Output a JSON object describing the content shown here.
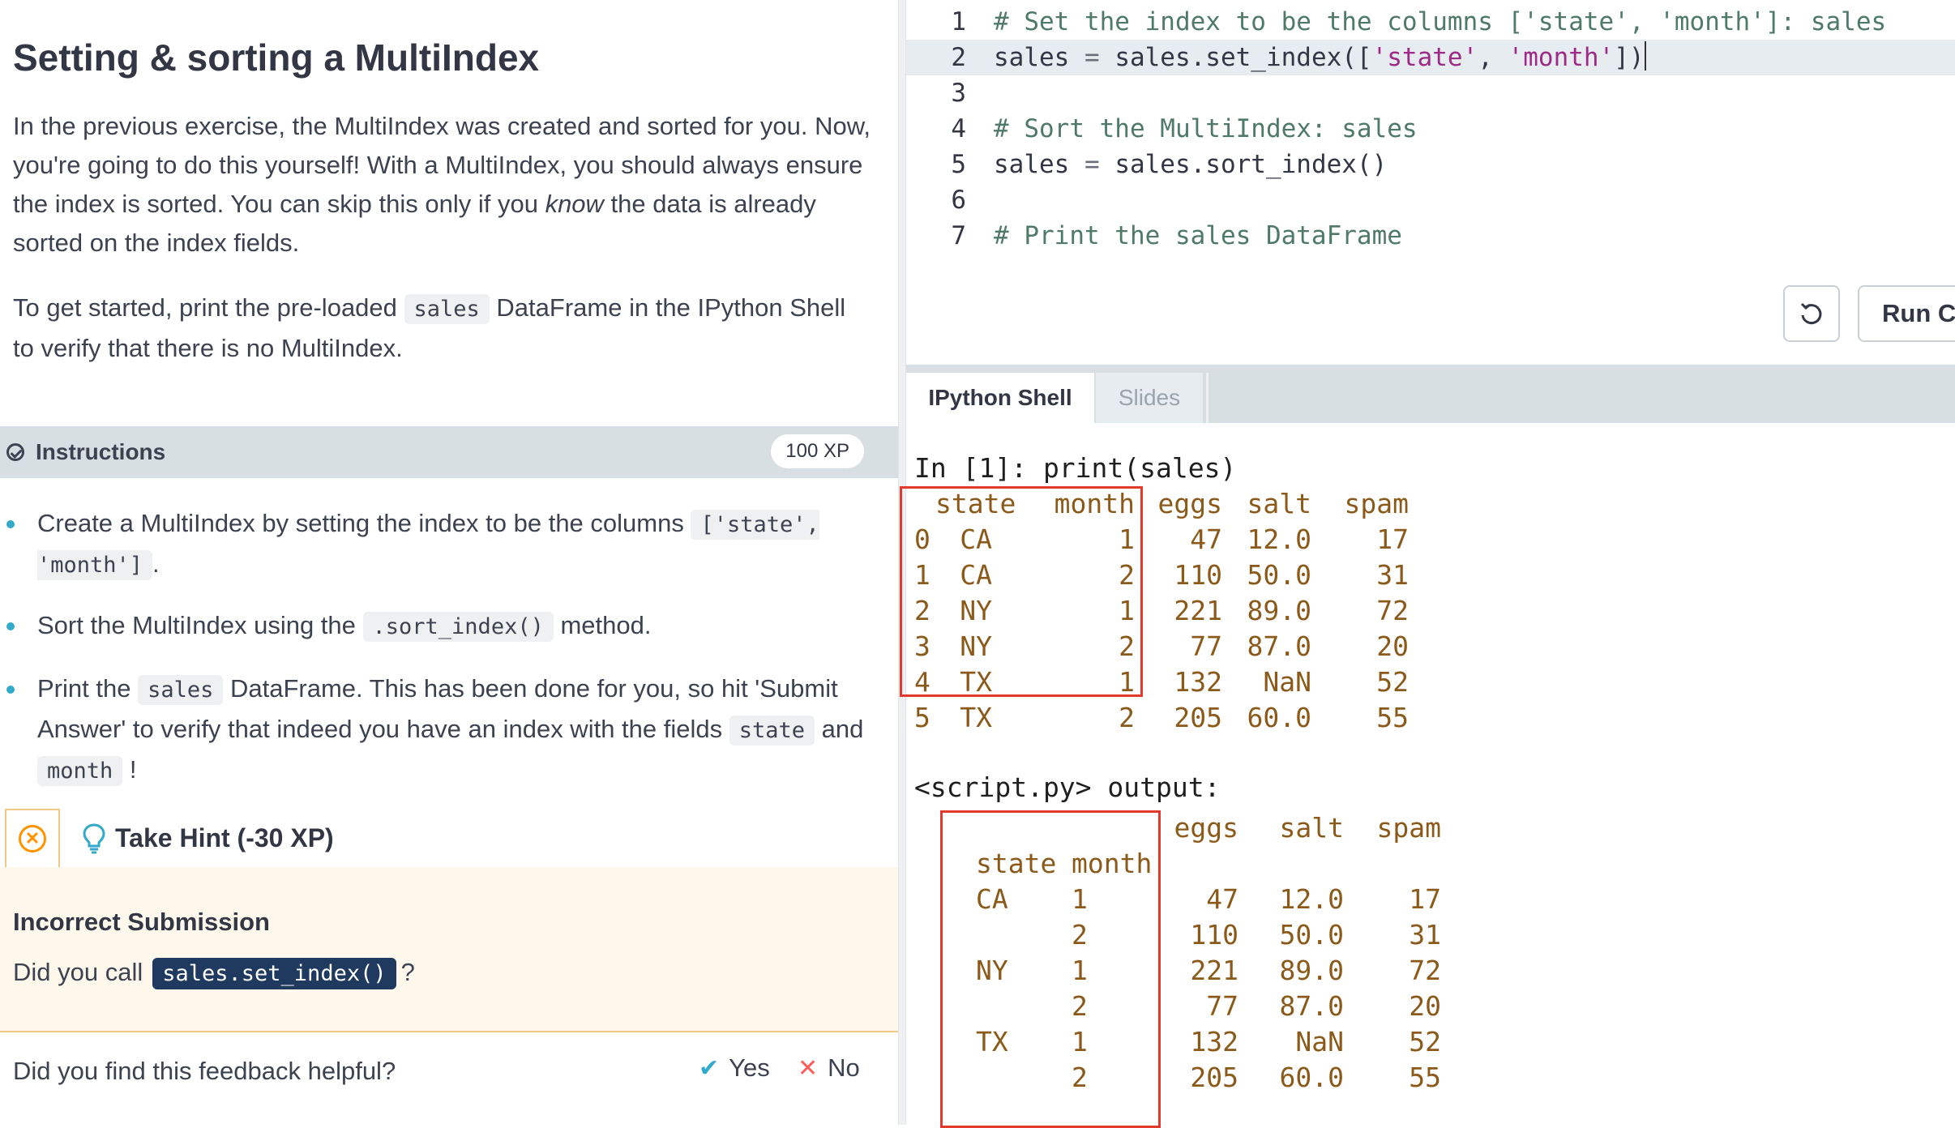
{
  "exercise": {
    "title": "Setting & sorting a MultiIndex",
    "intro": {
      "p1_a": "In the previous exercise, the MultiIndex was created and sorted for you. Now, you're going to do this yourself! With a MultiIndex, you should always ensure the index is sorted. You can skip this only if you ",
      "p1_em": "know",
      "p1_b": " the data is already sorted on the index fields.",
      "p2_a": "To get started, print the pre-loaded ",
      "p2_code": "sales",
      "p2_b": " DataFrame in the IPython Shell to verify that there is no MultiIndex."
    }
  },
  "instructions": {
    "label": "Instructions",
    "xp": "100 XP",
    "items": [
      {
        "a": "Create a MultiIndex by setting the index to be the columns ",
        "code": "['state', 'month']",
        "b": "."
      },
      {
        "a": "Sort the MultiIndex using the ",
        "code": ".sort_index()",
        "b": " method."
      },
      {
        "a": "Print the ",
        "code": "sales",
        "b": " DataFrame. This has been done for you, so hit 'Submit Answer' to verify that indeed you have an index with the fields ",
        "code2": "state",
        "c": " and ",
        "code3": "month",
        "d": " !"
      }
    ]
  },
  "hint": {
    "label": "Take Hint (-30 XP)"
  },
  "feedback": {
    "title": "Incorrect Submission",
    "text_a": "Did you call",
    "code": "sales.set_index()",
    "text_b": "?",
    "helpful_q": "Did you find this feedback helpful?",
    "yes": "Yes",
    "no": "No"
  },
  "editor": {
    "lines": [
      {
        "n": "1",
        "comment": "# Set the index to be the columns ['state', 'month']: sales"
      },
      {
        "n": "2",
        "pre": "sales ",
        "op": "=",
        "mid": " sales.set_index([",
        "s1": "'state'",
        "sep": ", ",
        "s2": "'month'",
        "post": "])"
      },
      {
        "n": "3"
      },
      {
        "n": "4",
        "comment": "# Sort the MultiIndex: sales"
      },
      {
        "n": "5",
        "pre": "sales ",
        "op": "=",
        "mid": " sales.sort_index()"
      },
      {
        "n": "6"
      },
      {
        "n": "7",
        "comment": "# Print the sales DataFrame"
      }
    ],
    "run_label": "Run Code"
  },
  "shell": {
    "tabs": [
      "IPython Shell",
      "Slides"
    ],
    "prompt": "In [1]: print(sales)",
    "table1": {
      "headers": [
        "state",
        "month",
        "eggs",
        "salt",
        "spam"
      ],
      "rows": [
        [
          "0",
          "CA",
          "1",
          "47",
          "12.0",
          "17"
        ],
        [
          "1",
          "CA",
          "2",
          "110",
          "50.0",
          "31"
        ],
        [
          "2",
          "NY",
          "1",
          "221",
          "89.0",
          "72"
        ],
        [
          "3",
          "NY",
          "2",
          "77",
          "87.0",
          "20"
        ],
        [
          "4",
          "TX",
          "1",
          "132",
          "NaN",
          "52"
        ],
        [
          "5",
          "TX",
          "2",
          "205",
          "60.0",
          "55"
        ]
      ]
    },
    "script_output": "<script.py> output:",
    "table2": {
      "columns": [
        "eggs",
        "salt",
        "spam"
      ],
      "index_names": [
        "state",
        "month"
      ],
      "rows": [
        [
          "CA",
          "1",
          "47",
          "12.0",
          "17"
        ],
        [
          "",
          "2",
          "110",
          "50.0",
          "31"
        ],
        [
          "NY",
          "1",
          "221",
          "89.0",
          "72"
        ],
        [
          "",
          "2",
          "77",
          "87.0",
          "20"
        ],
        [
          "TX",
          "1",
          "132",
          "NaN",
          "52"
        ],
        [
          "",
          "2",
          "205",
          "60.0",
          "55"
        ]
      ]
    }
  },
  "colors": {
    "accent": "#33aacc",
    "warning": "#ff9400",
    "highlight_box": "#e23b2e",
    "feedback_bg": "#fef7ec",
    "code_badge_bg": "#1f3a5e"
  }
}
